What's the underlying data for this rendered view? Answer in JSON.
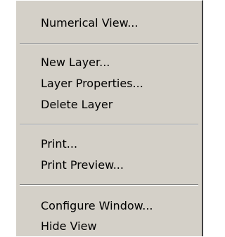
{
  "menu": {
    "items": [
      {
        "label": "Numerical View..."
      },
      {
        "label": "New Layer..."
      },
      {
        "label": "Layer Properties..."
      },
      {
        "label": "Delete Layer"
      },
      {
        "label": "Print..."
      },
      {
        "label": "Print Preview..."
      },
      {
        "label": "Configure Window..."
      },
      {
        "label": "Hide View"
      }
    ]
  },
  "colors": {
    "menu_background": "#d4d0c8",
    "separator_shadow": "#808080",
    "separator_highlight": "#ffffff",
    "text": "#000000"
  }
}
